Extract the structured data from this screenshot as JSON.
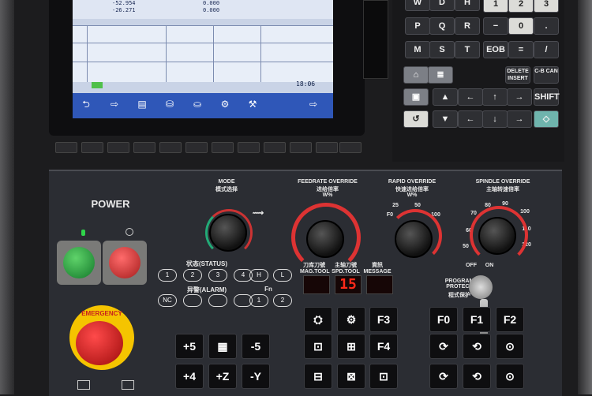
{
  "screen": {
    "top_values": [
      "-52.954",
      "-26.271",
      "0.000",
      "0.000"
    ],
    "time": "18:06",
    "softkey_labels": [
      "",
      "",
      "",
      "",
      "",
      "",
      "",
      ""
    ]
  },
  "keypad": {
    "keys": [
      "D",
      "1",
      "2",
      "3",
      "P",
      "Q",
      "0",
      ".",
      "R",
      "T",
      "M",
      "EOB",
      "DELETE INSERT",
      "C-B CAN",
      "SHIFT"
    ]
  },
  "panel": {
    "power": "POWER",
    "mode_en": "MODE",
    "mode_cn": "模式选择",
    "feed_en": "FEEDRATE OVERRIDE",
    "feed_cn": "进给倍率",
    "feed_unit": "W%",
    "rapid_en": "RAPID OVERRIDE",
    "rapid_cn": "快速进给倍率",
    "rapid_unit": "W%",
    "rapid_ticks": [
      "F0",
      "25",
      "50",
      "100"
    ],
    "spindle_en": "SPINDLE OVERRIDE",
    "spindle_cn": "主轴转速倍率",
    "spindle_ticks": [
      "70",
      "80",
      "90",
      "100",
      "110",
      "120",
      "60",
      "50"
    ],
    "status": "状态(STATUS)",
    "alarm": "异警(ALARM)",
    "fn": "Fn",
    "mag_tool": "刀库刀號 MAG.TOOL",
    "spd_tool": "主轴刀號 SPD.TOOL",
    "message": "資訊 MESSAGE",
    "seg_value": "15",
    "protect": "PROGRAM PROTECT",
    "protect_cn": "程式保护",
    "off": "OFF",
    "on": "ON",
    "emergency": "EMERGENCY",
    "status_btns": [
      "1",
      "2",
      "3",
      "4",
      "H",
      "L"
    ],
    "alarm_btns": [
      "NC",
      "",
      "",
      "",
      "1",
      "2"
    ],
    "f_keys": [
      "F3",
      "F0",
      "F1",
      "F2",
      "F4"
    ],
    "jog_keys": [
      "+5",
      "-5",
      "+4",
      "+Z",
      "-Y"
    ]
  }
}
